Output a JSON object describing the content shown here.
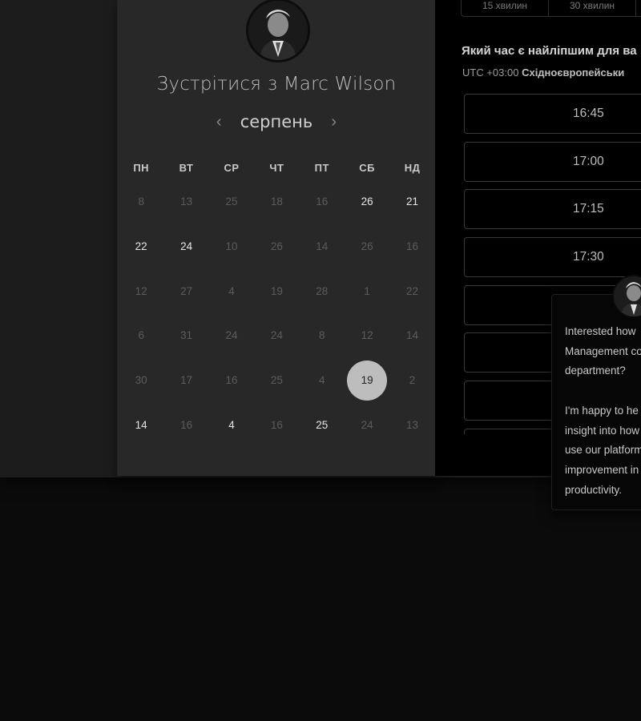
{
  "scheduler": {
    "title": "Зустрітися з Marc Wilson",
    "month": "серпень",
    "weekdays": [
      "ПН",
      "ВТ",
      "СР",
      "ЧТ",
      "ПТ",
      "СБ",
      "НД"
    ],
    "weeks": [
      [
        {
          "d": "8",
          "a": false
        },
        {
          "d": "13",
          "a": false
        },
        {
          "d": "25",
          "a": false
        },
        {
          "d": "18",
          "a": false
        },
        {
          "d": "16",
          "a": false
        },
        {
          "d": "26",
          "a": true
        },
        {
          "d": "21",
          "a": true
        }
      ],
      [
        {
          "d": "22",
          "a": true
        },
        {
          "d": "24",
          "a": true
        },
        {
          "d": "10",
          "a": false
        },
        {
          "d": "26",
          "a": false
        },
        {
          "d": "14",
          "a": false
        },
        {
          "d": "26",
          "a": false
        },
        {
          "d": "16",
          "a": false
        }
      ],
      [
        {
          "d": "12",
          "a": false
        },
        {
          "d": "27",
          "a": false
        },
        {
          "d": "4",
          "a": false
        },
        {
          "d": "19",
          "a": false
        },
        {
          "d": "28",
          "a": false
        },
        {
          "d": "1",
          "a": false
        },
        {
          "d": "22",
          "a": false
        }
      ],
      [
        {
          "d": "6",
          "a": false
        },
        {
          "d": "31",
          "a": false
        },
        {
          "d": "24",
          "a": false
        },
        {
          "d": "24",
          "a": false
        },
        {
          "d": "8",
          "a": false
        },
        {
          "d": "12",
          "a": false
        },
        {
          "d": "14",
          "a": false
        }
      ],
      [
        {
          "d": "30",
          "a": false
        },
        {
          "d": "17",
          "a": false
        },
        {
          "d": "16",
          "a": false
        },
        {
          "d": "25",
          "a": false
        },
        {
          "d": "4",
          "a": false
        },
        {
          "d": "19",
          "a": true,
          "s": true
        },
        {
          "d": "2",
          "a": false
        }
      ],
      [
        {
          "d": "14",
          "a": true
        },
        {
          "d": "16",
          "a": false
        },
        {
          "d": "4",
          "a": true
        },
        {
          "d": "16",
          "a": false
        },
        {
          "d": "25",
          "a": true
        },
        {
          "d": "24",
          "a": false
        },
        {
          "d": "13",
          "a": false
        }
      ]
    ]
  },
  "durations": [
    "15 хвилин",
    "30 хвилин",
    ""
  ],
  "time_panel": {
    "question": "Який час є найліпшим для ва",
    "timezone_prefix": "UTC +03:00",
    "timezone_name": "Східноєвропейськи",
    "slots": [
      "16:45",
      "17:00",
      "17:15",
      "17:30",
      "",
      "",
      "",
      ""
    ]
  },
  "chat": {
    "message": "Interested how\nManagement co\ndepartment?\n\nI'm happy to he\ninsight into how\nuse our platform\nimprovement in\nproductivity."
  }
}
